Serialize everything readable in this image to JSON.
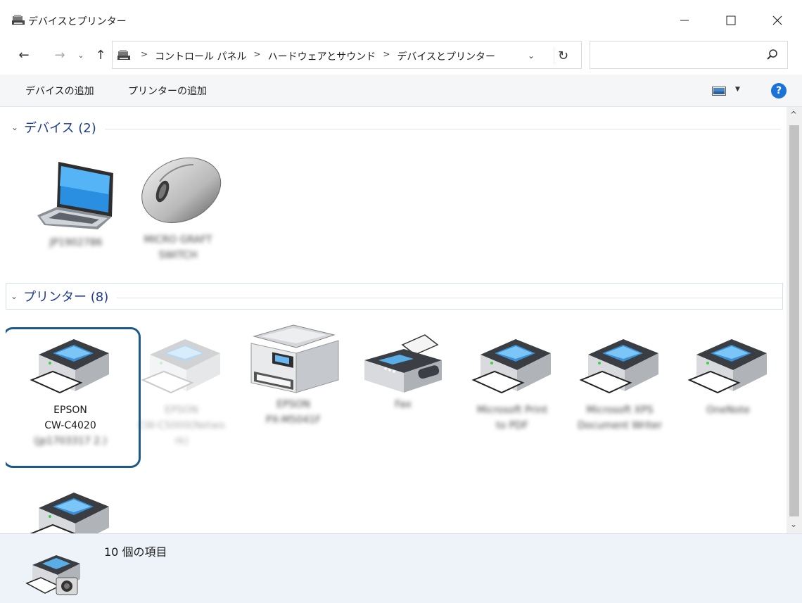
{
  "window": {
    "title": "デバイスとプリンター",
    "minimize_glyph": "—",
    "maximize_glyph": "☐",
    "close_glyph": "✕"
  },
  "nav": {
    "back_glyph": "←",
    "forward_glyph": "→",
    "recent_glyph": "⌄",
    "up_glyph": "↑",
    "breadcrumbs": [
      "コントロール パネル",
      "ハードウェアとサウンド",
      "デバイスとプリンター"
    ],
    "crumb_separator": ">",
    "dropdown_glyph": "⌄",
    "refresh_glyph": "↻",
    "search_placeholder": ""
  },
  "commands": {
    "add_device": "デバイスの追加",
    "add_printer": "プリンターの追加",
    "help_glyph": "?"
  },
  "groups": {
    "devices": {
      "label": "デバイス (2)"
    },
    "printers": {
      "label": "プリンター (8)"
    }
  },
  "devices": [
    {
      "label": "JP1902786",
      "icon": "laptop-icon"
    },
    {
      "label": "MICRO GRAFT SWITCH",
      "icon": "mouse-icon"
    }
  ],
  "printers": [
    {
      "label_lines": [
        "EPSON",
        "CW-C4020",
        "(jp1703317 2.)"
      ],
      "icon": "printer-icon",
      "selected": true
    },
    {
      "label_lines": [
        "EPSON",
        "CW-C5000(Netwo",
        "rk)"
      ],
      "icon": "printer-icon"
    },
    {
      "label_lines": [
        "EPSON",
        "PX-M5041F"
      ],
      "icon": "multifunction-printer-icon"
    },
    {
      "label_lines": [
        "Fax"
      ],
      "icon": "fax-icon"
    },
    {
      "label_lines": [
        "Microsoft Print",
        "to PDF"
      ],
      "icon": "printer-icon"
    },
    {
      "label_lines": [
        "Microsoft XPS",
        "Document Writer"
      ],
      "icon": "printer-icon"
    },
    {
      "label_lines": [
        "OneNote"
      ],
      "icon": "printer-icon"
    }
  ],
  "details": {
    "item_count": "10 個の項目"
  },
  "colors": {
    "group_header": "#1e3b8f",
    "selection_border": "#1c5a8c",
    "details_background": "#eef3fa",
    "help_blue": "#1b72d8"
  }
}
